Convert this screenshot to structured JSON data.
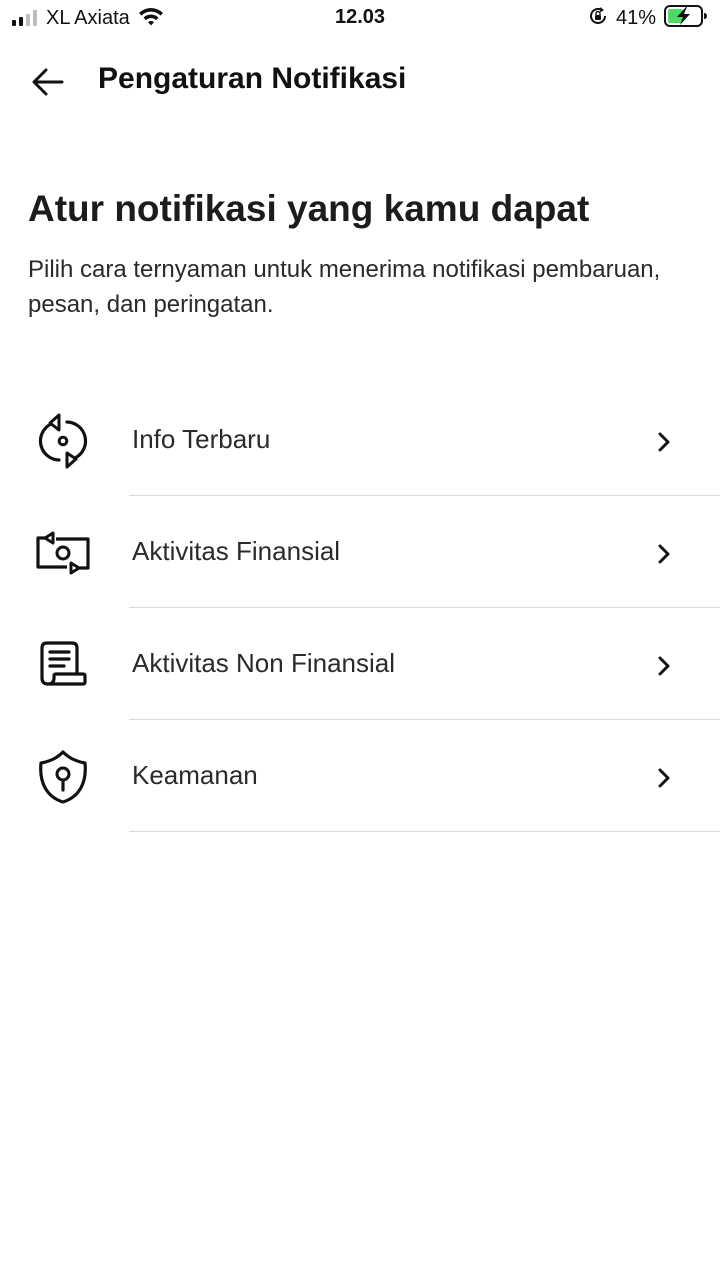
{
  "status_bar": {
    "carrier": "XL Axiata",
    "time": "12.03",
    "battery_percent": "41%",
    "signal_bars": 4,
    "signal_bars_active": 2,
    "battery_charging": true,
    "battery_color": "#4cd964"
  },
  "app_bar": {
    "title": "Pengaturan Notifikasi",
    "back_icon": "arrow-left-icon"
  },
  "content": {
    "headline": "Atur notifikasi yang kamu dapat",
    "description": "Pilih cara ternyaman untuk menerima notifikasi pembaruan, pesan, dan peringatan."
  },
  "menu": {
    "items": [
      {
        "label": "Info Terbaru",
        "icon": "info-update-icon"
      },
      {
        "label": "Aktivitas Finansial",
        "icon": "money-transfer-icon"
      },
      {
        "label": "Aktivitas Non Finansial",
        "icon": "receipt-icon"
      },
      {
        "label": "Keamanan",
        "icon": "shield-lock-icon"
      }
    ]
  }
}
